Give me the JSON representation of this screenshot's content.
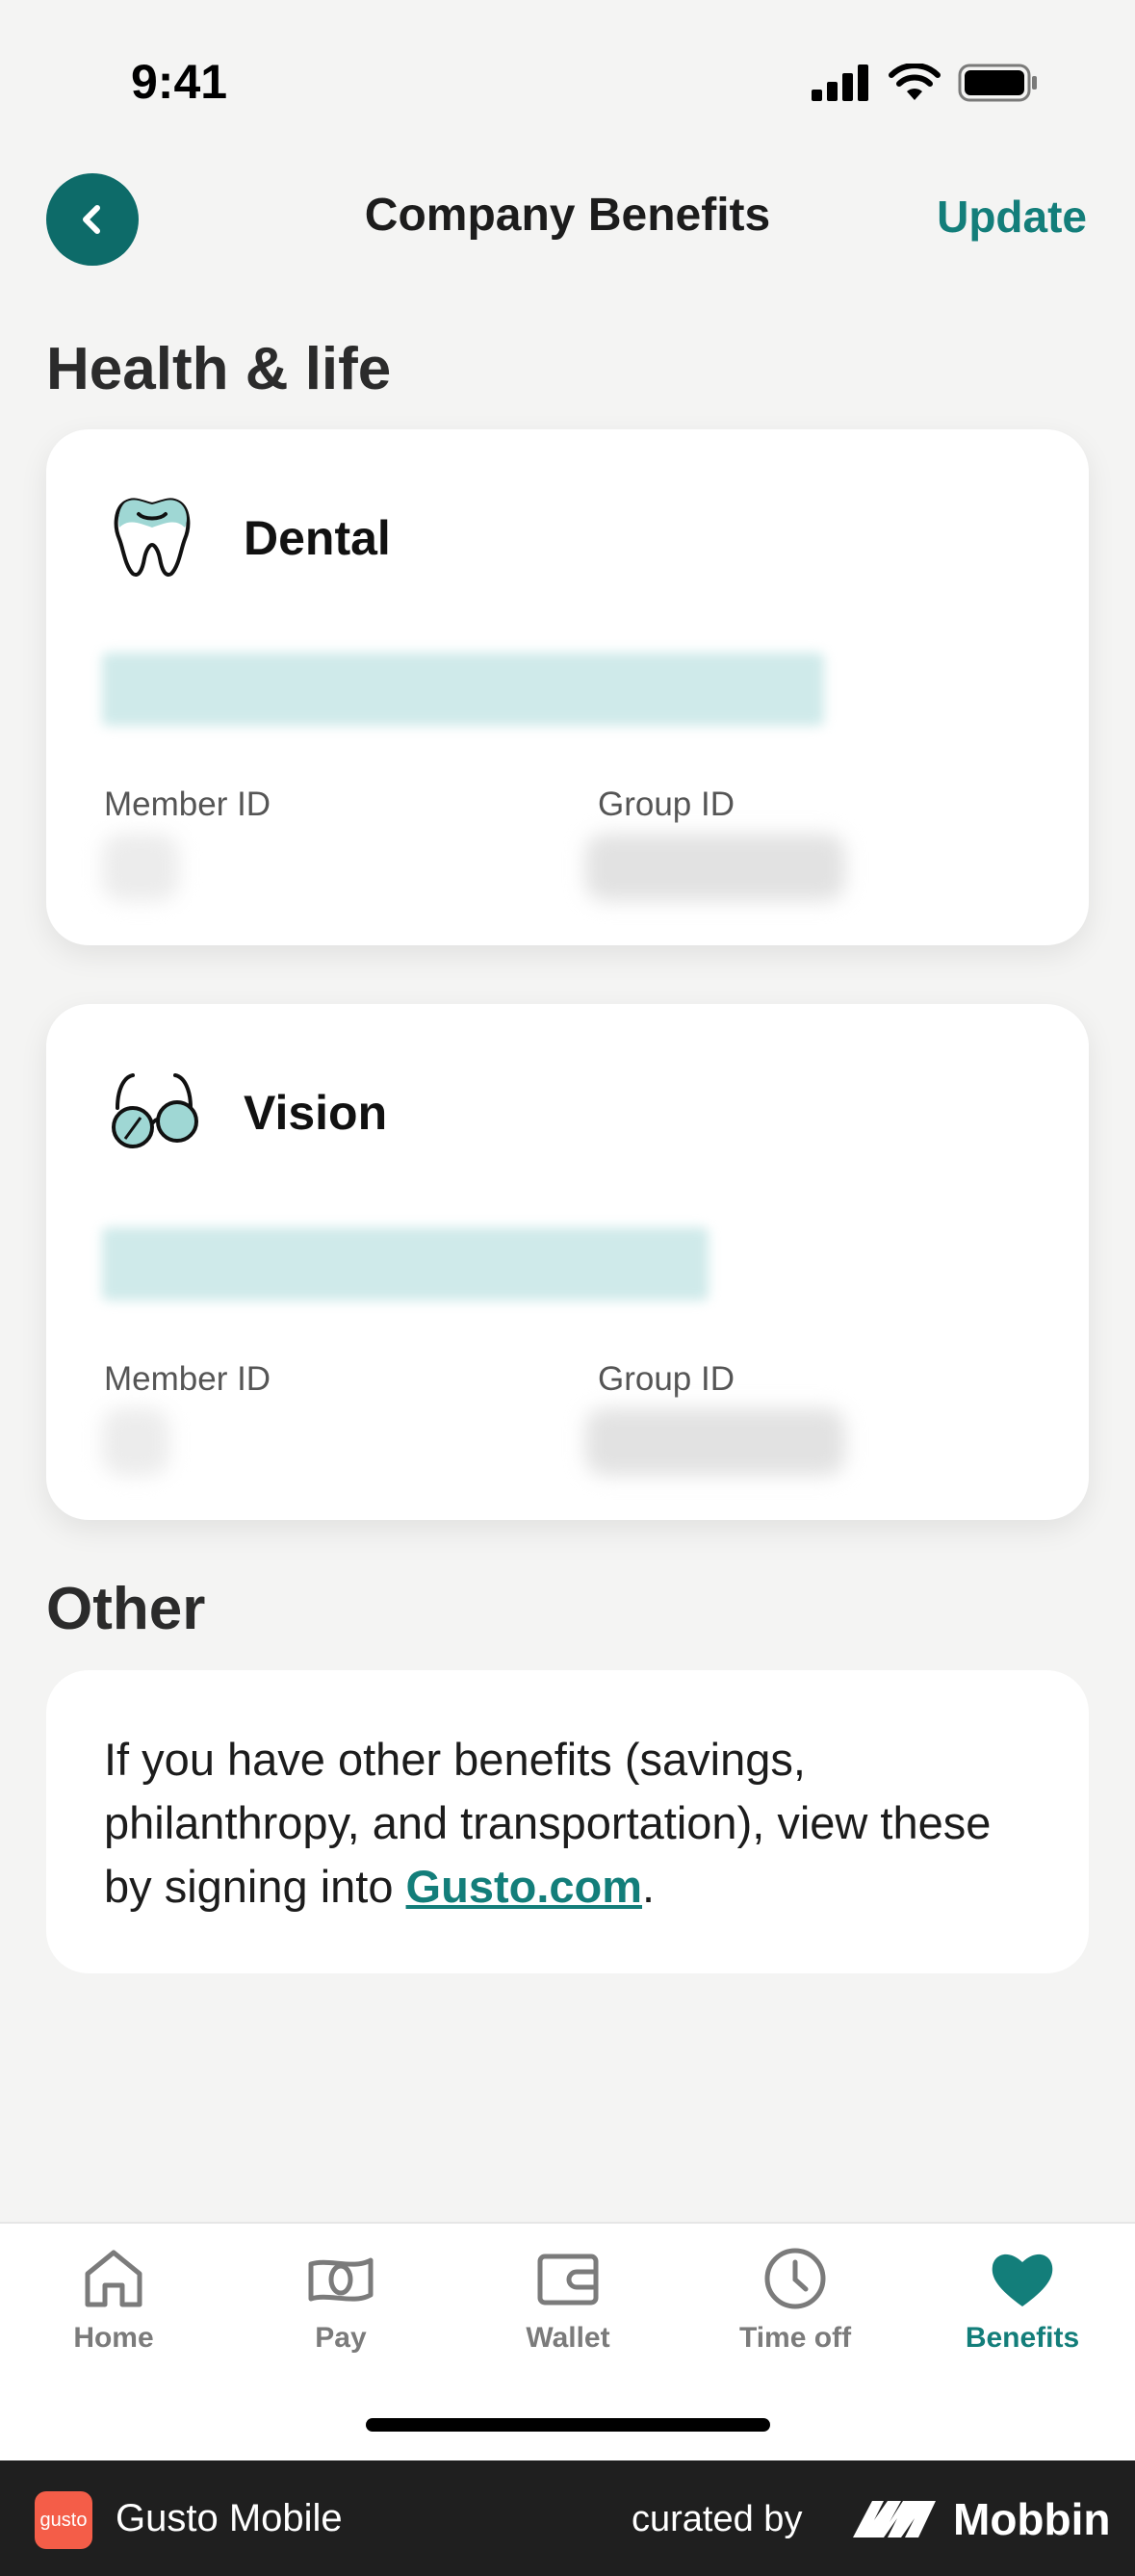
{
  "status_bar": {
    "time": "9:41"
  },
  "header": {
    "title": "Company Benefits",
    "update_label": "Update"
  },
  "sections": {
    "health_life": "Health & life",
    "other": "Other"
  },
  "cards": [
    {
      "title": "Dental",
      "member_id_label": "Member ID",
      "group_id_label": "Group ID"
    },
    {
      "title": "Vision",
      "member_id_label": "Member ID",
      "group_id_label": "Group ID"
    }
  ],
  "other_card": {
    "text_before": "If you have other benefits (savings, philanthropy, and transportation), view these by signing into ",
    "link": "Gusto.com",
    "text_after": "."
  },
  "tabs": [
    {
      "label": "Home",
      "icon": "home-icon"
    },
    {
      "label": "Pay",
      "icon": "pay-icon"
    },
    {
      "label": "Wallet",
      "icon": "wallet-icon"
    },
    {
      "label": "Time off",
      "icon": "clock-icon"
    },
    {
      "label": "Benefits",
      "icon": "heart-icon",
      "active": true
    }
  ],
  "footer": {
    "app_name": "Gusto Mobile",
    "logo_text": "gusto",
    "curated_by": "curated by",
    "brand": "Mobbin"
  },
  "colors": {
    "accent": "#137e7a",
    "back_button": "#0d6b69",
    "background": "#f4f4f3"
  }
}
